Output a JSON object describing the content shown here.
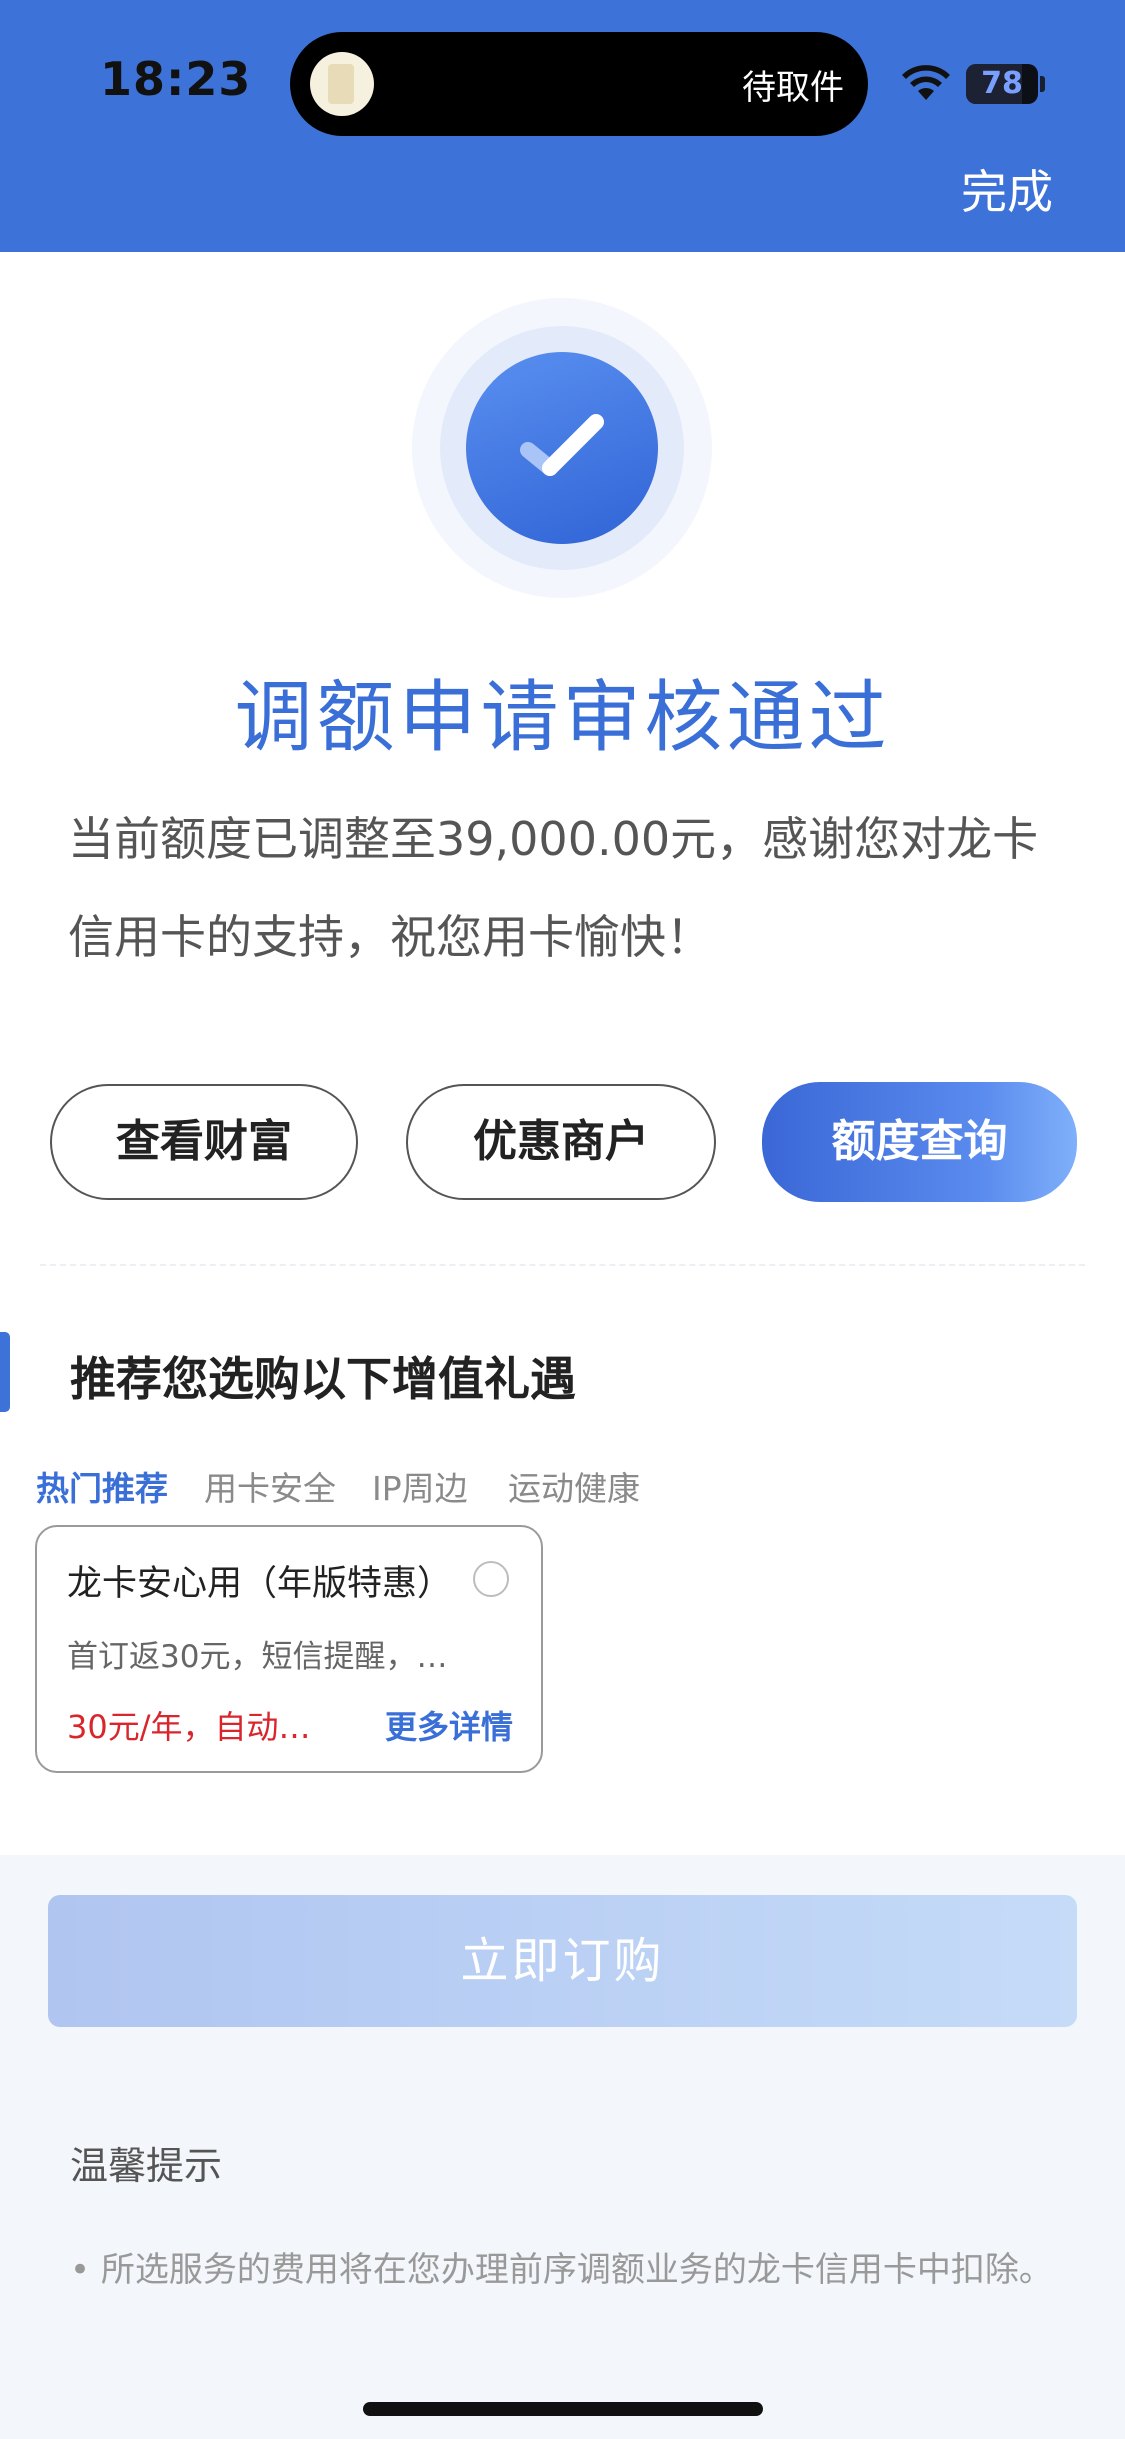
{
  "status_bar": {
    "time": "18:23",
    "island_text": "待取件",
    "battery": "78",
    "battery_level": 0.78
  },
  "header": {
    "done_label": "完成"
  },
  "result": {
    "title": "调额申请审核通过",
    "description": "当前额度已调整至39,000.00元，感谢您对龙卡信用卡的支持，祝您用卡愉快！"
  },
  "actions": {
    "view_wealth": "查看财富",
    "merchants": "优惠商户",
    "limit_query": "额度查询"
  },
  "recommend": {
    "title": "推荐您选购以下增值礼遇",
    "tabs": [
      {
        "label": "热门推荐",
        "active": true
      },
      {
        "label": "用卡安全",
        "active": false
      },
      {
        "label": "IP周边",
        "active": false
      },
      {
        "label": "运动健康",
        "active": false
      }
    ],
    "card": {
      "title": "龙卡安心用（年版特惠）",
      "desc": "首订返30元，短信提醒，…",
      "price": "30元/年，自动…",
      "more": "更多详情"
    }
  },
  "bottom": {
    "order_label": "立即订购",
    "tip_title": "温馨提示",
    "tip_text": "• 所选服务的费用将在您办理前序调额业务的龙卡信用卡中扣除。"
  },
  "colors": {
    "header_bg": "#3d72d8",
    "accent": "#3a6fd8",
    "price_red": "#d8262c"
  }
}
